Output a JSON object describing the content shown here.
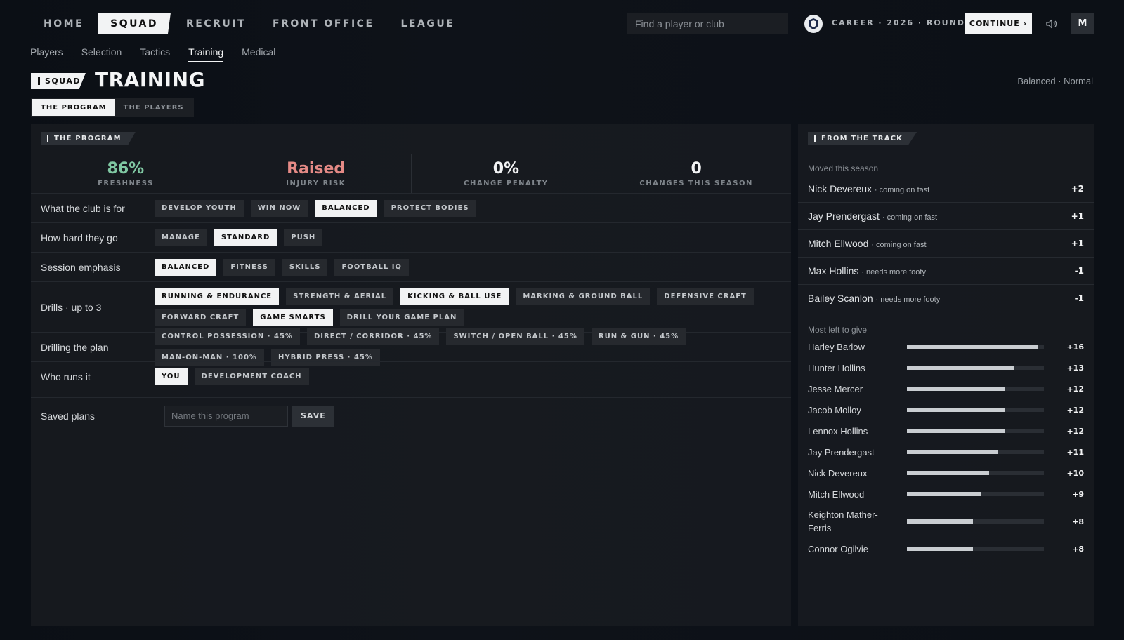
{
  "top_nav": [
    "HOME",
    "SQUAD",
    "RECRUIT",
    "FRONT OFFICE",
    "LEAGUE"
  ],
  "top_nav_active": "SQUAD",
  "search": {
    "placeholder": "Find a player or club"
  },
  "career": {
    "text": "CAREER · 2026 · ROUND 10",
    "continue_label": "CONTINUE ›"
  },
  "user": {
    "initial": "M"
  },
  "sub_nav": [
    "Players",
    "Selection",
    "Tactics",
    "Training",
    "Medical"
  ],
  "sub_nav_active": "Training",
  "page": {
    "breadcrumb": "SQUAD",
    "title": "TRAINING",
    "mode": "Balanced · Normal",
    "tabs": [
      "THE PROGRAM",
      "THE PLAYERS"
    ],
    "active_tab": "THE PROGRAM"
  },
  "program": {
    "tag": "THE PROGRAM",
    "stats": [
      {
        "value": "86%",
        "label": "FRESHNESS",
        "color": "#7fc7a2"
      },
      {
        "value": "Raised",
        "label": "INJURY RISK",
        "color": "#e58a86"
      },
      {
        "value": "0%",
        "label": "CHANGE PENALTY",
        "color": "#f2f3f4"
      },
      {
        "value": "0",
        "label": "CHANGES THIS SEASON",
        "color": "#f2f3f4"
      }
    ],
    "rows": [
      {
        "label": "What the club is for",
        "options": [
          "DEVELOP YOUTH",
          "WIN NOW",
          "BALANCED",
          "PROTECT BODIES"
        ],
        "selected": [
          "BALANCED"
        ]
      },
      {
        "label": "How hard they go",
        "options": [
          "MANAGE",
          "STANDARD",
          "PUSH"
        ],
        "selected": [
          "STANDARD"
        ]
      },
      {
        "label": "Session emphasis",
        "options": [
          "BALANCED",
          "FITNESS",
          "SKILLS",
          "FOOTBALL IQ"
        ],
        "selected": [
          "BALANCED"
        ]
      },
      {
        "label": "Drills · up to 3",
        "options": [
          "RUNNING & ENDURANCE",
          "STRENGTH & AERIAL",
          "KICKING & BALL USE",
          "MARKING & GROUND BALL",
          "DEFENSIVE CRAFT",
          "FORWARD CRAFT",
          "GAME SMARTS",
          "DRILL YOUR GAME PLAN"
        ],
        "selected": [
          "RUNNING & ENDURANCE",
          "KICKING & BALL USE",
          "GAME SMARTS"
        ]
      },
      {
        "label": "Drilling the plan",
        "options": [
          "CONTROL POSSESSION · 45%",
          "DIRECT / CORRIDOR · 45%",
          "SWITCH / OPEN BALL · 45%",
          "RUN & GUN · 45%",
          "MAN-ON-MAN · 100%",
          "HYBRID PRESS · 45%"
        ],
        "selected": []
      },
      {
        "label": "Who runs it",
        "options": [
          "YOU",
          "DEVELOPMENT COACH"
        ],
        "selected": [
          "YOU"
        ]
      }
    ],
    "saved": {
      "label": "Saved plans",
      "placeholder": "Name this program",
      "save_label": "SAVE"
    }
  },
  "track": {
    "tag": "FROM THE TRACK",
    "moved_title": "Moved this season",
    "moved": [
      {
        "name": "Nick Devereux",
        "note": "· coming on fast",
        "delta": "+2"
      },
      {
        "name": "Jay Prendergast",
        "note": "· coming on fast",
        "delta": "+1"
      },
      {
        "name": "Mitch Ellwood",
        "note": "· coming on fast",
        "delta": "+1"
      },
      {
        "name": "Max Hollins",
        "note": "· needs more footy",
        "delta": "-1"
      },
      {
        "name": "Bailey Scanlon",
        "note": "· needs more footy",
        "delta": "-1"
      }
    ],
    "left_title": "Most left to give",
    "left": [
      {
        "name": "Harley Barlow",
        "delta": "+16",
        "fill": 0.96
      },
      {
        "name": "Hunter Hollins",
        "delta": "+13",
        "fill": 0.78
      },
      {
        "name": "Jesse Mercer",
        "delta": "+12",
        "fill": 0.72
      },
      {
        "name": "Jacob Molloy",
        "delta": "+12",
        "fill": 0.72
      },
      {
        "name": "Lennox Hollins",
        "delta": "+12",
        "fill": 0.72
      },
      {
        "name": "Jay Prendergast",
        "delta": "+11",
        "fill": 0.66
      },
      {
        "name": "Nick Devereux",
        "delta": "+10",
        "fill": 0.6
      },
      {
        "name": "Mitch Ellwood",
        "delta": "+9",
        "fill": 0.54
      },
      {
        "name": "Keighton Mather-Ferris",
        "delta": "+8",
        "fill": 0.48
      },
      {
        "name": "Connor Ogilvie",
        "delta": "+8",
        "fill": 0.48
      }
    ]
  }
}
